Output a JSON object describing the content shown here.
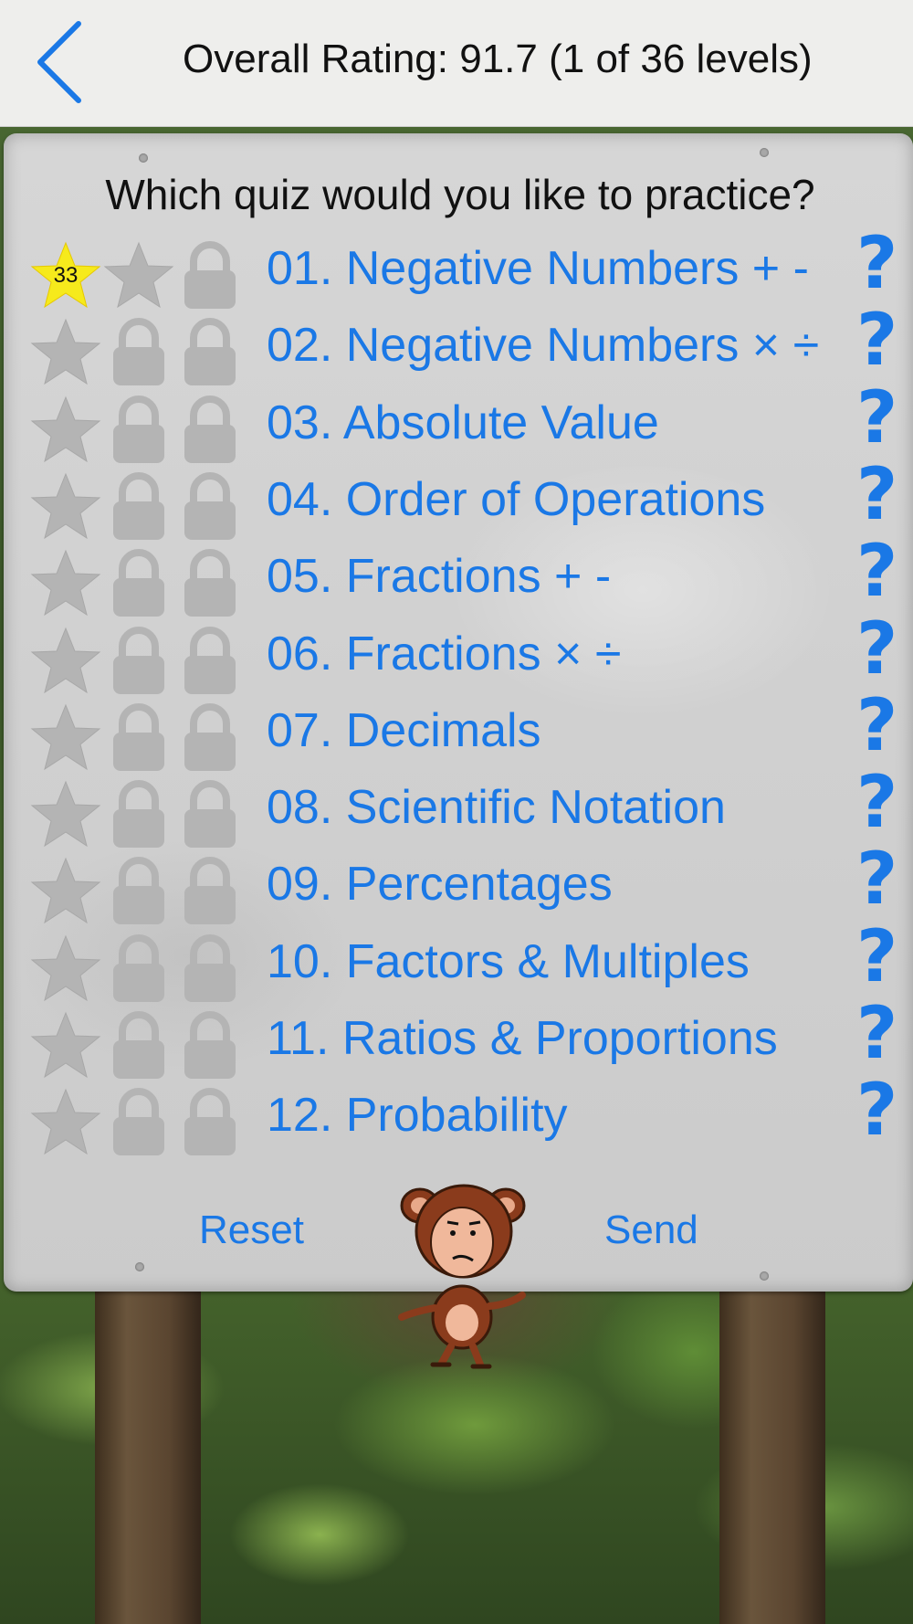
{
  "header": {
    "title": "Overall Rating: 91.7 (1 of 36 levels)",
    "accent": "#1a78e6"
  },
  "prompt": "Which quiz would you like to practice?",
  "quizzes": [
    {
      "label": "01. Negative Numbers + -",
      "stars": [
        "gold-star-icon",
        "gray-star-icon",
        "lock-icon"
      ],
      "badge": "33"
    },
    {
      "label": "02. Negative Numbers × ÷",
      "stars": [
        "gray-star-icon",
        "lock-icon",
        "lock-icon"
      ]
    },
    {
      "label": "03. Absolute Value",
      "stars": [
        "gray-star-icon",
        "lock-icon",
        "lock-icon"
      ]
    },
    {
      "label": "04. Order of Operations",
      "stars": [
        "gray-star-icon",
        "lock-icon",
        "lock-icon"
      ]
    },
    {
      "label": "05. Fractions + -",
      "stars": [
        "gray-star-icon",
        "lock-icon",
        "lock-icon"
      ]
    },
    {
      "label": "06. Fractions × ÷",
      "stars": [
        "gray-star-icon",
        "lock-icon",
        "lock-icon"
      ]
    },
    {
      "label": "07. Decimals",
      "stars": [
        "gray-star-icon",
        "lock-icon",
        "lock-icon"
      ]
    },
    {
      "label": "08. Scientific Notation",
      "stars": [
        "gray-star-icon",
        "lock-icon",
        "lock-icon"
      ]
    },
    {
      "label": "09. Percentages",
      "stars": [
        "gray-star-icon",
        "lock-icon",
        "lock-icon"
      ]
    },
    {
      "label": "10. Factors & Multiples",
      "stars": [
        "gray-star-icon",
        "lock-icon",
        "lock-icon"
      ]
    },
    {
      "label": "11. Ratios & Proportions",
      "stars": [
        "gray-star-icon",
        "lock-icon",
        "lock-icon"
      ]
    },
    {
      "label": "12. Probability",
      "stars": [
        "gray-star-icon",
        "lock-icon",
        "lock-icon"
      ]
    }
  ],
  "help_label": "?",
  "footer": {
    "reset_label": "Reset",
    "send_label": "Send"
  },
  "colors": {
    "gold_star": "#f6ea1c",
    "gray_icon": "#b4b4b4"
  }
}
